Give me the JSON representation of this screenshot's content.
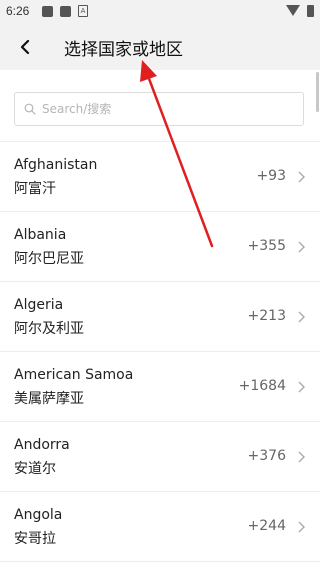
{
  "status_bar": {
    "time": "6:26",
    "icons": [
      "app-icon",
      "app-icon",
      "a-icon",
      "wifi-icon",
      "battery-icon"
    ]
  },
  "header": {
    "title": "选择国家或地区",
    "back_icon": "chevron-left-icon"
  },
  "search": {
    "placeholder": "Search/搜索",
    "value": ""
  },
  "countries": [
    {
      "name_en": "Afghanistan",
      "name_zh": "阿富汗",
      "code": "+93"
    },
    {
      "name_en": "Albania",
      "name_zh": "阿尔巴尼亚",
      "code": "+355"
    },
    {
      "name_en": "Algeria",
      "name_zh": "阿尔及利亚",
      "code": "+213"
    },
    {
      "name_en": "American Samoa",
      "name_zh": "美属萨摩亚",
      "code": "+1684"
    },
    {
      "name_en": "Andorra",
      "name_zh": "安道尔",
      "code": "+376"
    },
    {
      "name_en": "Angola",
      "name_zh": "安哥拉",
      "code": "+244"
    }
  ],
  "colors": {
    "header_bg": "#f2f2f2",
    "annotation_arrow": "#e02020",
    "divider": "#ececec"
  }
}
